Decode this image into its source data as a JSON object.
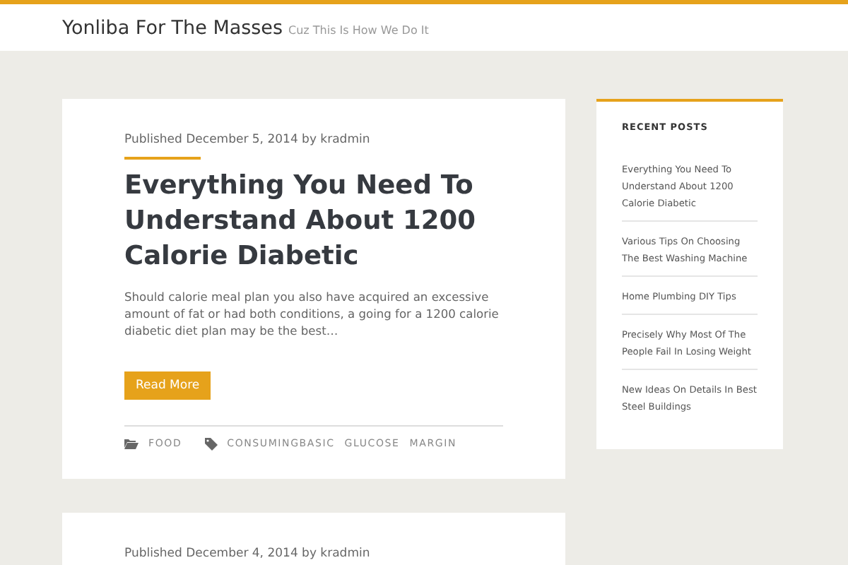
{
  "site": {
    "title": "Yonliba For The Masses",
    "tagline": "Cuz This Is How We Do It"
  },
  "posts": [
    {
      "meta": "Published December 5, 2014 by kradmin",
      "title": "Everything You Need To Understand About 1200 Calorie Diabetic",
      "excerpt": "Should calorie meal plan you also have acquired an excessive amount of fat or had both conditions, a going for a 1200 calorie diabetic diet plan may be the best…",
      "button": "Read More",
      "category": "FOOD",
      "tags": [
        "CONSUMINGBASIC",
        "GLUCOSE",
        "MARGIN"
      ]
    },
    {
      "meta": "Published December 4, 2014 by kradmin"
    }
  ],
  "sidebar": {
    "heading": "RECENT POSTS",
    "items": [
      "Everything You Need To Understand About 1200 Calorie Diabetic",
      "Various Tips On Choosing The Best Washing Machine",
      "Home Plumbing DIY Tips",
      "Precisely Why Most Of The People Fail In Losing Weight",
      "New Ideas On Details In Best Steel Buildings"
    ]
  }
}
